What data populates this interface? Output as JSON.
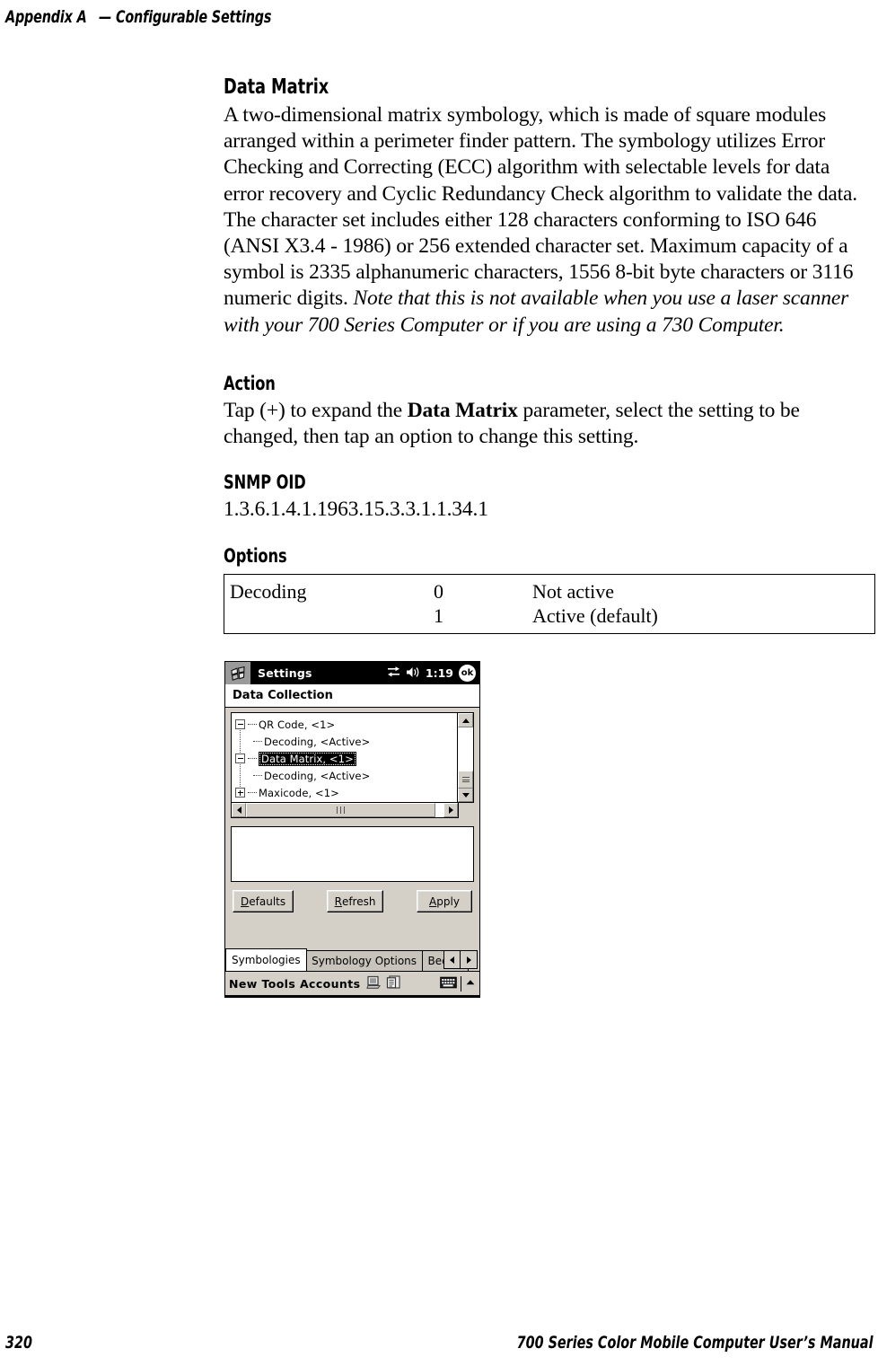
{
  "running_head": {
    "appendix": "Appendix A",
    "dash": "—",
    "title": "Configurable Settings"
  },
  "sections": {
    "data_matrix": {
      "heading": "Data Matrix",
      "body_roman": "A two-dimensional matrix symbology, which is made of square modules arranged within a perimeter finder pattern. The symbology utilizes Error Checking and Correcting (ECC) algorithm with selectable levels for data error recovery and Cyclic Redundancy Check algorithm to validate the data. The character set includes either 128 characters conforming to ISO 646 (ANSI X3.4 - 1986) or 256 extended character set. Maximum capacity of a symbol is 2335 alphanumeric characters, 1556 8-bit byte characters or 3116 numeric digits. ",
      "body_italic": "Note that this is not available when you use a laser scanner with your 700 Series Computer or if you are using a 730 Computer."
    },
    "action": {
      "heading": "Action",
      "text_before": "Tap (+) to expand the ",
      "text_bold": "Data Matrix",
      "text_after": " parameter, select the setting to be changed, then tap an option to change this setting."
    },
    "snmp_oid": {
      "heading": "SNMP OID",
      "value": "1.3.6.1.4.1.1963.15.3.3.1.1.34.1"
    },
    "options": {
      "heading": "Options",
      "rows": [
        {
          "name": "Decoding",
          "value": "0",
          "description": "Not active"
        },
        {
          "name": "",
          "value": "1",
          "description": "Active (default)"
        }
      ]
    }
  },
  "pda": {
    "titlebar": {
      "start_icon": "windows-flag-icon",
      "title": "Settings",
      "connectivity_icon": "connectivity-icon",
      "volume_icon": "speaker-icon",
      "clock": "1:19",
      "ok_label": "ok"
    },
    "page_header": "Data Collection",
    "tree": [
      {
        "label": "QR Code, <1>",
        "level": 0,
        "state": "expanded",
        "selected": false
      },
      {
        "label": "Decoding, <Active>",
        "level": 1,
        "state": "leaf",
        "selected": false
      },
      {
        "label": "Data Matrix, <1>",
        "level": 0,
        "state": "expanded",
        "selected": true
      },
      {
        "label": "Decoding, <Active>",
        "level": 1,
        "state": "leaf",
        "selected": false
      },
      {
        "label": "Maxicode, <1>",
        "level": 0,
        "state": "collapsed",
        "selected": false
      }
    ],
    "value_panel": "",
    "buttons": [
      {
        "accel": "D",
        "rest": "efaults"
      },
      {
        "accel": "R",
        "rest": "efresh"
      },
      {
        "accel": "A",
        "rest": "pply"
      }
    ],
    "tabs": [
      {
        "label": "Symbologies",
        "active": true,
        "clipped": false
      },
      {
        "label": "Symbology Options",
        "active": false,
        "clipped": false
      },
      {
        "label": "Beeper",
        "active": false,
        "clipped": true
      }
    ],
    "tab_scroll": {
      "left": "scroll-left",
      "right": "scroll-right"
    },
    "taskbar": {
      "menu": "New Tools Accounts",
      "icons": [
        "monitor-icon",
        "document-list-icon"
      ],
      "tray": [
        "keyboard-icon",
        "chevron-up-icon"
      ]
    }
  },
  "footer": {
    "page_number": "320",
    "manual_title": "700 Series Color Mobile Computer User’s Manual"
  }
}
